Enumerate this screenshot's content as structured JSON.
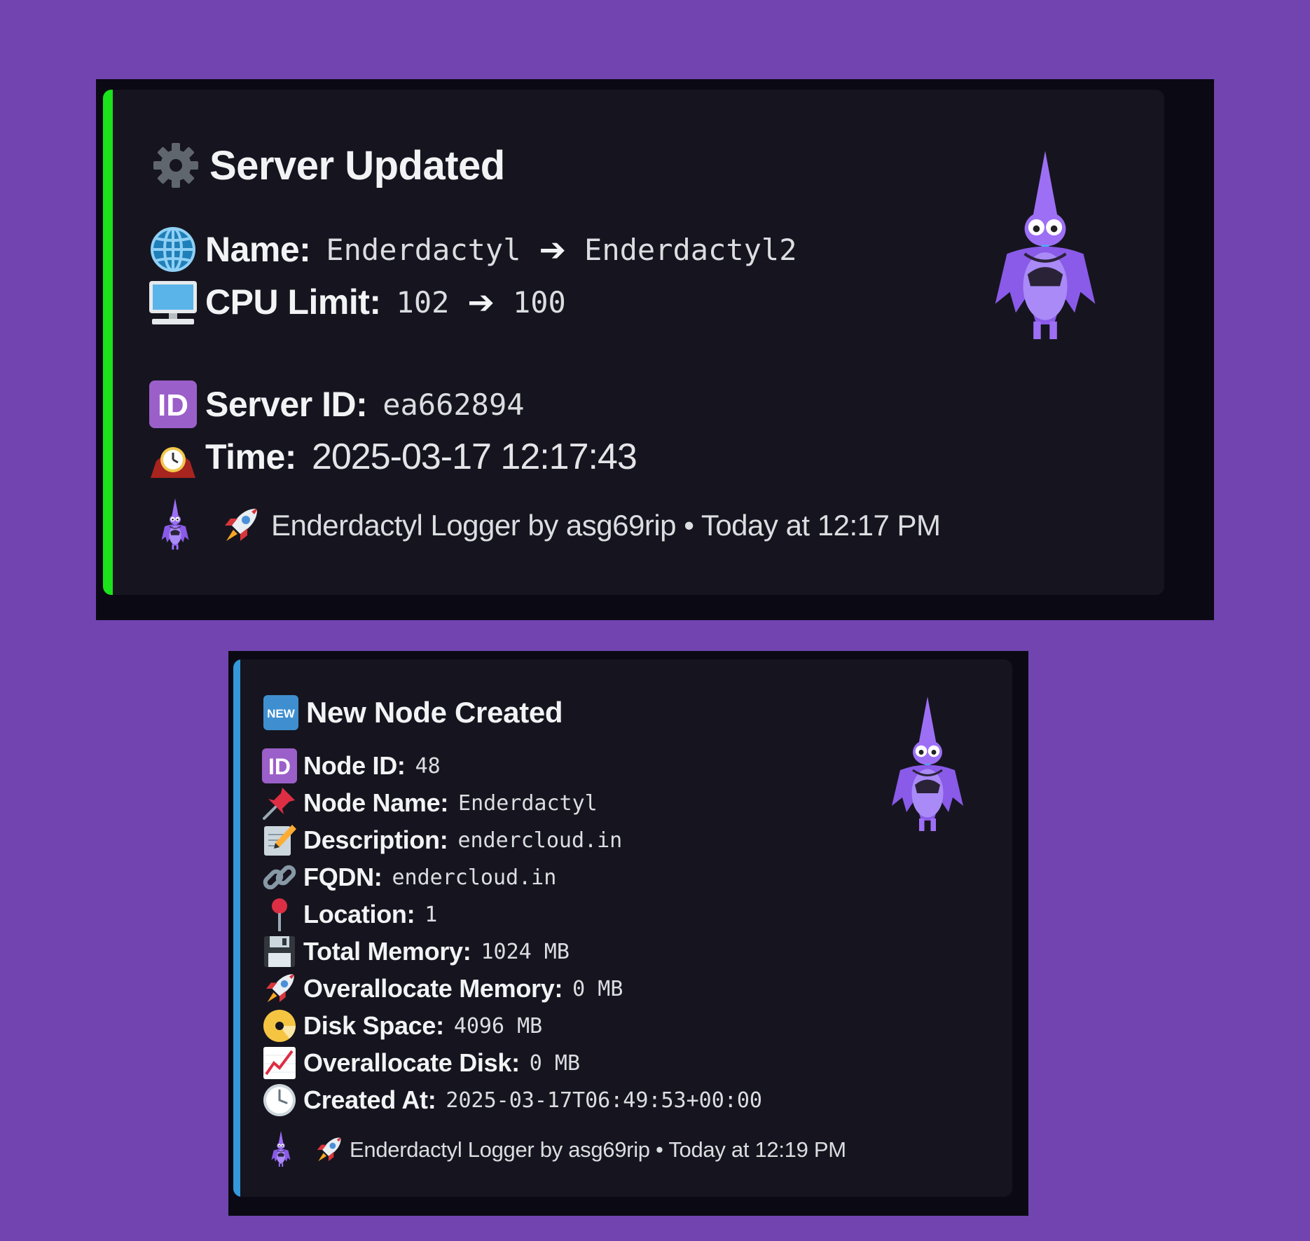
{
  "colors": {
    "background": "#7144af",
    "frame": "#0b0a14",
    "embed": "#16151f",
    "accent_green": "#1be21b",
    "accent_blue": "#3498db",
    "mascot": "#9b6cf4"
  },
  "embeds": [
    {
      "title_icon": "gear-icon",
      "title": "Server Updated",
      "name": {
        "label": "Name:",
        "old": "Enderdactyl",
        "arrow": "➔",
        "new": "Enderdactyl2"
      },
      "cpu": {
        "label": "CPU Limit:",
        "old": "102",
        "arrow": "➔",
        "new": "100"
      },
      "server_id": {
        "label": "Server ID:",
        "value": "ea662894"
      },
      "time": {
        "label": "Time:",
        "value": "2025-03-17 12:17:43"
      },
      "footer": {
        "text": "Enderdactyl Logger by asg69rip • Today at 12:17 PM"
      }
    },
    {
      "title_icon": "new-badge-icon",
      "title": "New Node Created",
      "fields": [
        {
          "icon": "id-badge-icon",
          "label": "Node ID:",
          "value": "48"
        },
        {
          "icon": "pushpin-icon",
          "label": "Node Name:",
          "value": "Enderdactyl"
        },
        {
          "icon": "memo-icon",
          "label": "Description:",
          "value": "endercloud.in"
        },
        {
          "icon": "link-icon",
          "label": "FQDN:",
          "value": "endercloud.in"
        },
        {
          "icon": "round-pushpin-icon",
          "label": "Location:",
          "value": "1"
        },
        {
          "icon": "floppy-disk-icon",
          "label": "Total Memory:",
          "value": "1024 MB"
        },
        {
          "icon": "rocket-icon",
          "label": "Overallocate Memory:",
          "value": "0 MB"
        },
        {
          "icon": "dvd-icon",
          "label": "Disk Space:",
          "value": "4096 MB"
        },
        {
          "icon": "chart-increasing-icon",
          "label": "Overallocate Disk:",
          "value": "0 MB"
        },
        {
          "icon": "clock-icon",
          "label": "Created At:",
          "value": "2025-03-17T06:49:53+00:00"
        }
      ],
      "footer": {
        "text": "Enderdactyl Logger by asg69rip • Today at 12:19 PM"
      }
    }
  ]
}
